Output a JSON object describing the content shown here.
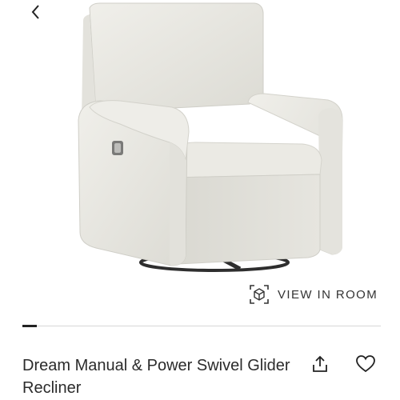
{
  "header": {
    "back_icon": "chevron-left-icon"
  },
  "gallery": {
    "image_subject": "recliner-chair-photo",
    "slide_progress": 0.04,
    "view_in_room_label": "VIEW IN ROOM",
    "view_in_room_icon": "ar-cube-icon"
  },
  "product": {
    "title": "Dream Manual & Power Swivel Glider Recliner",
    "share_icon": "share-icon",
    "favorite_icon": "heart-icon"
  }
}
